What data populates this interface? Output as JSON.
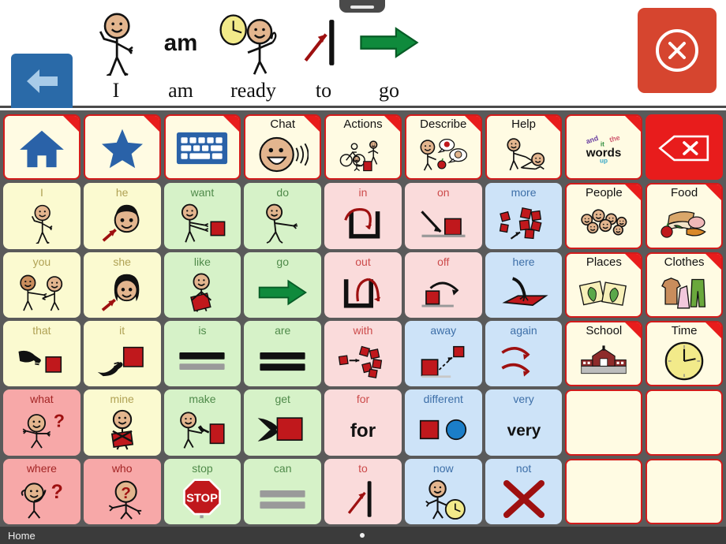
{
  "app": {
    "status_bar": {
      "home_label": "Home",
      "dot": "●"
    }
  },
  "message_bar": {
    "back_button": {
      "name": "back",
      "icon": "left-arrow-icon"
    },
    "close_button": {
      "name": "close",
      "icon": "close-circle-icon"
    },
    "grab_handle": "drag-handle",
    "sentence_text": "I am ready to go",
    "words": [
      {
        "text": "I",
        "symbol": "person-pointing-self"
      },
      {
        "text": "am",
        "symbol": "word-am"
      },
      {
        "text": "ready",
        "symbol": "clock-person-thumbs-up"
      },
      {
        "text": "to",
        "symbol": "arrow-to-line"
      },
      {
        "text": "go",
        "symbol": "green-right-arrow"
      }
    ]
  },
  "grid": {
    "columns": 9,
    "rows": 6,
    "cells": [
      {
        "label": "",
        "palette": "cream",
        "symbol": "home-icon",
        "folder": true
      },
      {
        "label": "",
        "palette": "cream",
        "symbol": "star-icon",
        "folder": true
      },
      {
        "label": "",
        "palette": "cream",
        "symbol": "keyboard-icon",
        "folder": true
      },
      {
        "label": "Chat",
        "palette": "cream",
        "symbol": "talking-face",
        "folder": true
      },
      {
        "label": "Actions",
        "palette": "cream",
        "symbol": "people-actions",
        "folder": true
      },
      {
        "label": "Describe",
        "palette": "cream",
        "symbol": "person-speech-bubbles",
        "folder": true
      },
      {
        "label": "Help",
        "palette": "cream",
        "symbol": "person-helping",
        "folder": true
      },
      {
        "label": "",
        "palette": "cream",
        "symbol": "words-cloud",
        "folder": true
      },
      {
        "label": "",
        "palette": "red",
        "symbol": "backspace-icon",
        "folder": false
      },
      {
        "label": "I",
        "palette": "yellow",
        "symbol": "person-pointing-self",
        "folder": false
      },
      {
        "label": "he",
        "palette": "yellow",
        "symbol": "boy-face-arrow",
        "folder": false
      },
      {
        "label": "want",
        "palette": "green",
        "symbol": "person-reaching-block",
        "folder": false
      },
      {
        "label": "do",
        "palette": "green",
        "symbol": "person-doing",
        "folder": false
      },
      {
        "label": "in",
        "palette": "pink",
        "symbol": "arrow-into-container",
        "folder": false
      },
      {
        "label": "on",
        "palette": "pink",
        "symbol": "arrow-onto-block",
        "folder": false
      },
      {
        "label": "more",
        "palette": "blue",
        "symbol": "many-blocks",
        "folder": false
      },
      {
        "label": "People",
        "palette": "cream",
        "symbol": "group-of-faces",
        "folder": true
      },
      {
        "label": "Food",
        "palette": "cream",
        "symbol": "food-items",
        "folder": true
      },
      {
        "label": "you",
        "palette": "yellow",
        "symbol": "two-people-pointing",
        "folder": false
      },
      {
        "label": "she",
        "palette": "yellow",
        "symbol": "girl-face-arrow",
        "folder": false
      },
      {
        "label": "like",
        "palette": "green",
        "symbol": "person-hugging-block",
        "folder": false
      },
      {
        "label": "go",
        "palette": "green",
        "symbol": "green-right-arrow",
        "folder": false
      },
      {
        "label": "out",
        "palette": "pink",
        "symbol": "arrow-out-container",
        "folder": false
      },
      {
        "label": "off",
        "palette": "pink",
        "symbol": "arrow-off-block",
        "folder": false
      },
      {
        "label": "here",
        "palette": "blue",
        "symbol": "pointing-at-surface",
        "folder": false
      },
      {
        "label": "Places",
        "palette": "cream",
        "symbol": "maps-icon",
        "folder": true
      },
      {
        "label": "Clothes",
        "palette": "cream",
        "symbol": "clothing-items",
        "folder": true
      },
      {
        "label": "that",
        "palette": "yellow",
        "symbol": "hand-pointing-far-block",
        "folder": false
      },
      {
        "label": "it",
        "palette": "yellow",
        "symbol": "hand-pointing-block",
        "folder": false
      },
      {
        "label": "is",
        "palette": "green",
        "symbol": "equals-black-grey",
        "folder": false
      },
      {
        "label": "are",
        "palette": "green",
        "symbol": "equals-black-black",
        "folder": false
      },
      {
        "label": "with",
        "palette": "pink",
        "symbol": "block-joining-group",
        "folder": false
      },
      {
        "label": "away",
        "palette": "blue",
        "symbol": "block-moving-away",
        "folder": false
      },
      {
        "label": "again",
        "palette": "blue",
        "symbol": "two-curved-arrows",
        "folder": false
      },
      {
        "label": "School",
        "palette": "cream",
        "symbol": "school-building",
        "folder": true
      },
      {
        "label": "Time",
        "palette": "cream",
        "symbol": "clock-face",
        "folder": true
      },
      {
        "label": "what",
        "palette": "rose",
        "symbol": "person-shrug-question",
        "folder": false
      },
      {
        "label": "mine",
        "palette": "yellow",
        "symbol": "person-arms-crossed-block",
        "folder": false
      },
      {
        "label": "make",
        "palette": "green",
        "symbol": "person-hammer-block",
        "folder": false
      },
      {
        "label": "get",
        "palette": "green",
        "symbol": "hands-grabbing-block",
        "folder": false
      },
      {
        "label": "for",
        "palette": "pink",
        "symbol": "text-for",
        "text": "for",
        "folder": false
      },
      {
        "label": "different",
        "palette": "blue",
        "symbol": "square-and-circle",
        "folder": false
      },
      {
        "label": "very",
        "palette": "blue",
        "symbol": "text-very",
        "text": "very",
        "folder": false
      },
      {
        "label": "",
        "palette": "empty",
        "symbol": "",
        "folder": false
      },
      {
        "label": "",
        "palette": "empty",
        "symbol": "",
        "folder": false
      },
      {
        "label": "where",
        "palette": "rose",
        "symbol": "person-looking-question",
        "folder": false
      },
      {
        "label": "who",
        "palette": "rose",
        "symbol": "person-question-head",
        "folder": false
      },
      {
        "label": "stop",
        "palette": "green",
        "symbol": "stop-sign",
        "folder": false
      },
      {
        "label": "can",
        "palette": "green",
        "symbol": "equals-grey-grey",
        "folder": false
      },
      {
        "label": "to",
        "palette": "pink",
        "symbol": "arrow-to-line",
        "folder": false
      },
      {
        "label": "now",
        "palette": "blue",
        "symbol": "person-pointing-clock",
        "folder": false
      },
      {
        "label": "not",
        "palette": "blue",
        "symbol": "red-x",
        "folder": false
      },
      {
        "label": "",
        "palette": "empty",
        "symbol": "",
        "folder": false
      },
      {
        "label": "",
        "palette": "empty",
        "symbol": "",
        "folder": false
      }
    ]
  },
  "colors": {
    "grid_background": "#5a5a5a",
    "folder_border": "#d21b1b",
    "cream": "#fffbe3",
    "yellow": "#fbfad0",
    "green": "#d6f2c8",
    "pink": "#fadbdb",
    "rose": "#f7a8a8",
    "blue": "#cde3f8",
    "red": "#e81c1c",
    "back_button": "#2a6aa8",
    "close_button": "#d6452f",
    "status_bar": "#3b3b3b"
  },
  "words_key": {
    "and": "and",
    "it": "it",
    "the": "the",
    "words": "words",
    "up": "up",
    "and_color": "#6a3fa0",
    "it_color": "#2f8f3f",
    "the_color": "#d05a70",
    "words_color": "#111111",
    "up_color": "#3aa8c8"
  }
}
